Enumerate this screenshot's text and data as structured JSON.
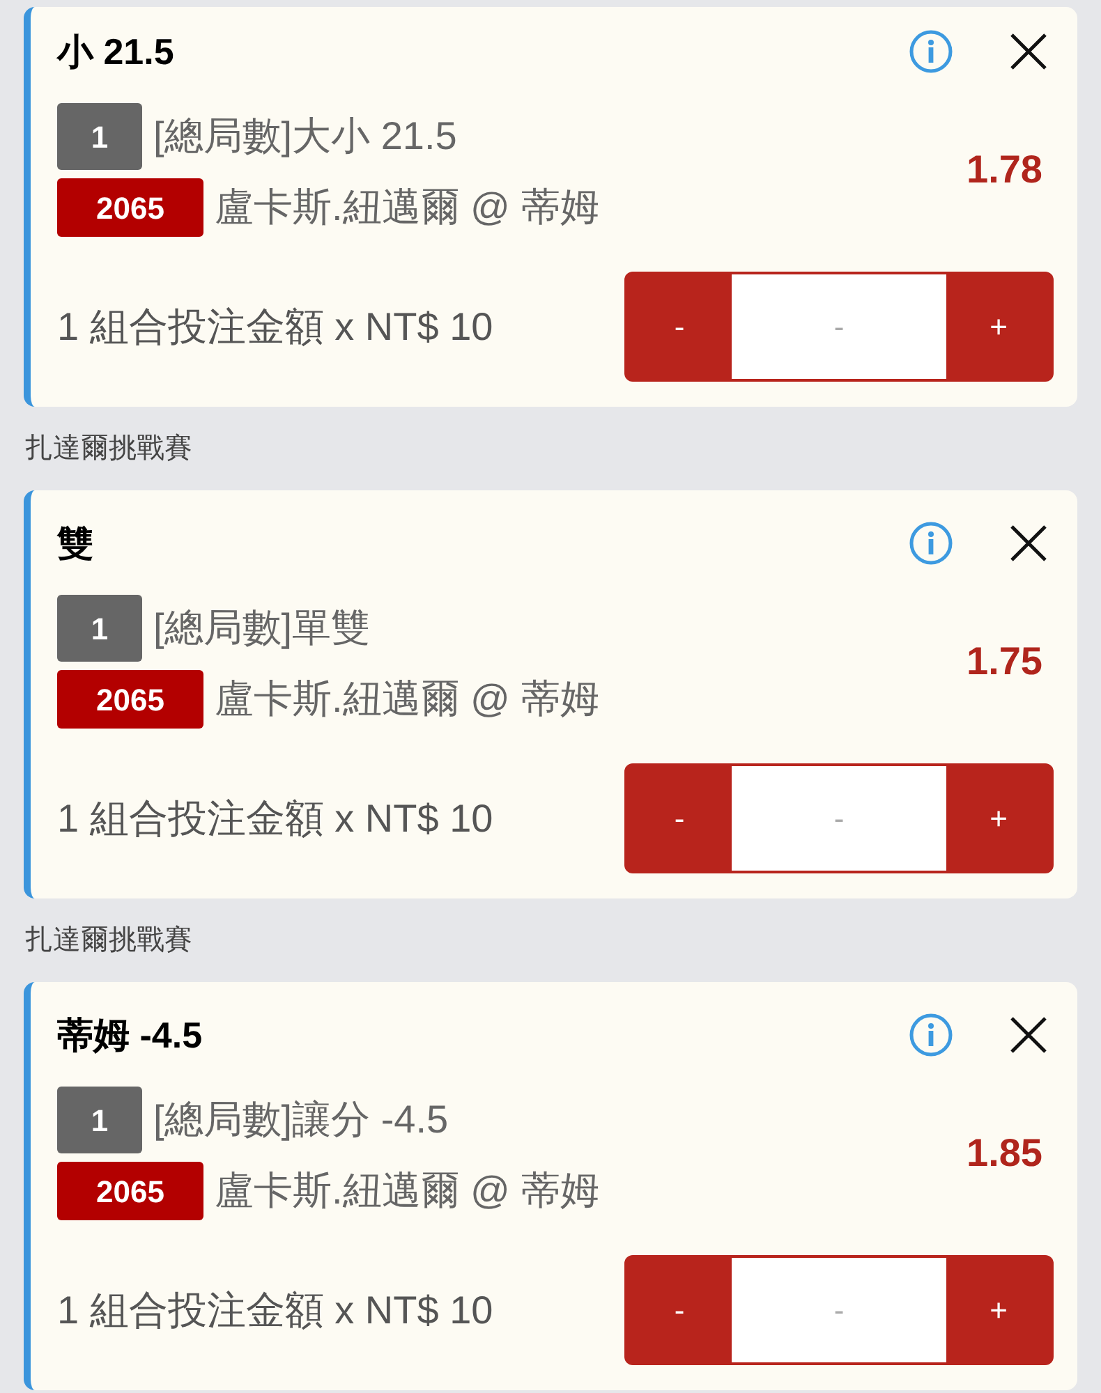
{
  "bets": [
    {
      "title": "小 21.5",
      "market_no": "1",
      "market": "[總局數]大小 21.5",
      "event_no": "2065",
      "event": "盧卡斯.紐邁爾 @ 蒂姆",
      "odds": "1.78",
      "stake_text": "1 組合投注金額 x NT$ 10",
      "minus": "-",
      "amount_placeholder": "-",
      "plus": "+"
    },
    {
      "league": "扎達爾挑戰賽",
      "title": "雙",
      "market_no": "1",
      "market": "[總局數]單雙",
      "event_no": "2065",
      "event": "盧卡斯.紐邁爾 @ 蒂姆",
      "odds": "1.75",
      "stake_text": "1 組合投注金額 x NT$ 10",
      "minus": "-",
      "amount_placeholder": "-",
      "plus": "+"
    },
    {
      "league": "扎達爾挑戰賽",
      "title": "蒂姆 -4.5",
      "market_no": "1",
      "market": "[總局數]讓分 -4.5",
      "event_no": "2065",
      "event": "盧卡斯.紐邁爾 @ 蒂姆",
      "odds": "1.85",
      "stake_text": "1 組合投注金額 x NT$ 10",
      "minus": "-",
      "amount_placeholder": "-",
      "plus": "+"
    }
  ]
}
